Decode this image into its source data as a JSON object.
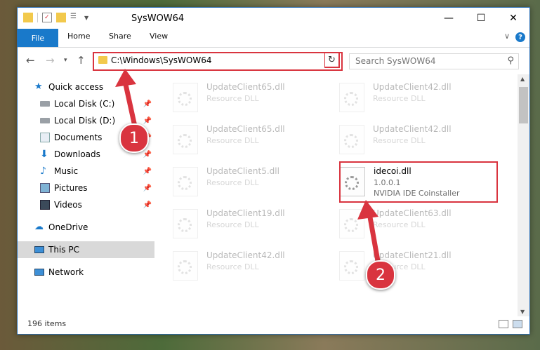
{
  "window": {
    "title": "SysWOW64"
  },
  "ribbon": {
    "tabs": [
      "File",
      "Home",
      "Share",
      "View"
    ],
    "help": "?"
  },
  "nav": {
    "address": "C:\\Windows\\SysWOW64",
    "search_placeholder": "Search SysWOW64"
  },
  "sidebar": {
    "items": [
      {
        "label": "Quick access",
        "icon": "star-icon"
      },
      {
        "label": "Local Disk (C:)",
        "icon": "drive-icon",
        "pinned": true
      },
      {
        "label": "Local Disk (D:)",
        "icon": "drive-icon",
        "pinned": true
      },
      {
        "label": "Documents",
        "icon": "documents-icon",
        "pinned": true
      },
      {
        "label": "Downloads",
        "icon": "download-icon",
        "pinned": true
      },
      {
        "label": "Music",
        "icon": "music-icon",
        "pinned": true
      },
      {
        "label": "Pictures",
        "icon": "pictures-icon",
        "pinned": true
      },
      {
        "label": "Videos",
        "icon": "videos-icon",
        "pinned": true
      },
      {
        "label": "OneDrive",
        "icon": "cloud-icon"
      },
      {
        "label": "This PC",
        "icon": "pc-icon",
        "selected": true
      },
      {
        "label": "Network",
        "icon": "network-icon"
      }
    ]
  },
  "files": [
    {
      "name": "UpdateClient65.dll",
      "desc": "Resource DLL"
    },
    {
      "name": "UpdateClient42.dll",
      "desc": "Resource DLL"
    },
    {
      "name": "UpdateClient65.dll",
      "desc": "Resource DLL"
    },
    {
      "name": "UpdateClient42.dll",
      "desc": "Resource DLL"
    },
    {
      "name": "UpdateClient5.dll",
      "desc": "Resource DLL"
    },
    {
      "name": "idecoi.dll",
      "version": "1.0.0.1",
      "desc": "NVIDIA IDE Coinstaller",
      "highlighted": true
    },
    {
      "name": "UpdateClient19.dll",
      "desc": "Resource DLL"
    },
    {
      "name": "UpdateClient63.dll",
      "desc": "Resource DLL"
    },
    {
      "name": "UpdateClient42.dll",
      "desc": "Resource DLL"
    },
    {
      "name": "UpdateClient21.dll",
      "desc": "Resource DLL"
    }
  ],
  "status": {
    "count": "196 items"
  },
  "annotations": {
    "step1": "1",
    "step2": "2"
  },
  "colors": {
    "accent": "#1979ca",
    "highlight": "#d9343f"
  }
}
